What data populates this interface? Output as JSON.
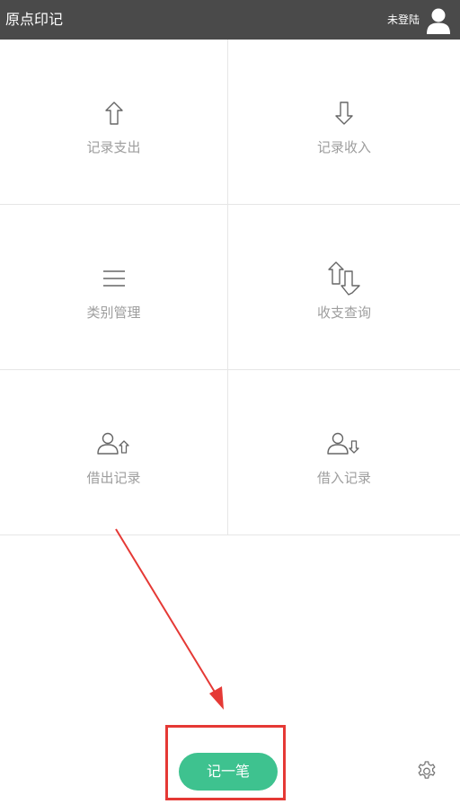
{
  "header": {
    "title": "原点印记",
    "login_status": "未登陆",
    "avatar_icon": "user-avatar-icon",
    "background": "#4a4a4a"
  },
  "menu": {
    "items": [
      {
        "label": "记录支出",
        "icon": "arrow-up-outline-icon"
      },
      {
        "label": "记录收入",
        "icon": "arrow-down-outline-icon"
      },
      {
        "label": "类别管理",
        "icon": "list-lines-icon"
      },
      {
        "label": "收支查询",
        "icon": "up-down-arrows-icon"
      },
      {
        "label": "借出记录",
        "icon": "person-arrow-up-icon"
      },
      {
        "label": "借入记录",
        "icon": "person-arrow-down-icon"
      }
    ]
  },
  "footer": {
    "record_button_label": "记一笔",
    "settings_icon": "gear-icon"
  },
  "colors": {
    "accent": "#3ec28f",
    "annotation": "#e53935",
    "label_gray": "#9e9e9e"
  }
}
